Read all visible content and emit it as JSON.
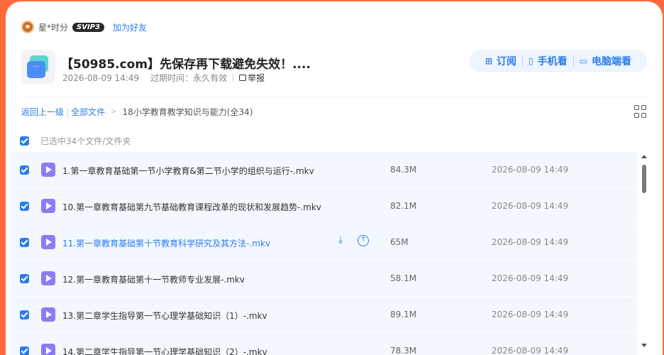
{
  "sharer": {
    "name": "星*时分",
    "badge": "SVIP3",
    "add_friend": "加为好友"
  },
  "share": {
    "title": "【50985.com】先保存再下载避免失效！....",
    "created": "2026-08-09 14:49",
    "expire_label": "过期时间：",
    "expire_value": "永久有效",
    "report": "举报"
  },
  "actions": [
    {
      "icon": "subscribe-icon",
      "label": "订阅"
    },
    {
      "icon": "phone-icon",
      "label": "手机看"
    },
    {
      "icon": "monitor-icon",
      "label": "电脑端看"
    }
  ],
  "breadcrumb": {
    "back": "返回上一级",
    "all": "全部文件",
    "current": "18小学教育教学知识与能力(全34)"
  },
  "selection": {
    "label": "已选中34个文件/文件夹"
  },
  "files": [
    {
      "name": "1.第一章教育基础第一节小学教育&第二节小学的组织与运行-.mkv",
      "size": "84.3M",
      "date": "2026-08-09 14:49"
    },
    {
      "name": "10.第一章教育基础第九节基础教育课程改革的现状和发展趋势-.mkv",
      "size": "82.1M",
      "date": "2026-08-09 14:49"
    },
    {
      "name": "11.第一章教育基础第十节教育科学研究及其方法-.mkv",
      "size": "65M",
      "date": "2026-08-09 14:49"
    },
    {
      "name": "12.第一章教育基础第十一节教师专业发展-.mkv",
      "size": "58.1M",
      "date": "2026-08-09 14:49"
    },
    {
      "name": "13.第二章学生指导第一节心理学基础知识（1）-.mkv",
      "size": "89.1M",
      "date": "2026-08-09 14:49"
    },
    {
      "name": "14.第二章学生指导第一节心理学基础知识（2）-.mkv",
      "size": "78.3M",
      "date": "2026-08-09 14:49"
    }
  ],
  "colors": {
    "accent": "#2b7ce9",
    "background": "#ff6a3d",
    "row_bg": "#f3f8fe",
    "video_icon": "#8a7cf6"
  }
}
